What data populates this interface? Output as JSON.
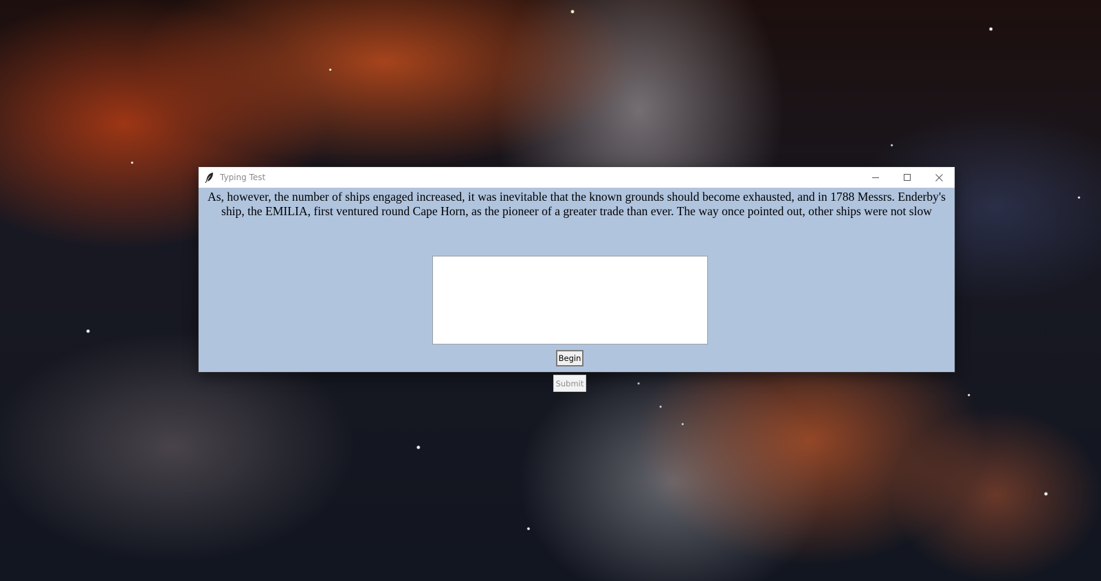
{
  "window": {
    "title": "Typing Test",
    "app_icon": "feather-icon",
    "controls": [
      "minimize-icon",
      "maximize-icon",
      "close-icon"
    ]
  },
  "prompt": {
    "text": "As, however, the number of ships engaged increased, it was inevitable that the known grounds should become exhausted, and in 1788 Messrs. Enderby's ship, the EMILIA, first ventured round Cape Horn, as the pioneer of a greater trade than ever. The way once pointed out, other ships were not slow"
  },
  "input": {
    "value": ""
  },
  "buttons": {
    "begin_label": "Begin",
    "submit_label": "Submit",
    "submit_enabled": false
  },
  "colors": {
    "window_background": "#b0c4de",
    "titlebar": "#ffffff",
    "title_text": "#8a8a8a"
  }
}
